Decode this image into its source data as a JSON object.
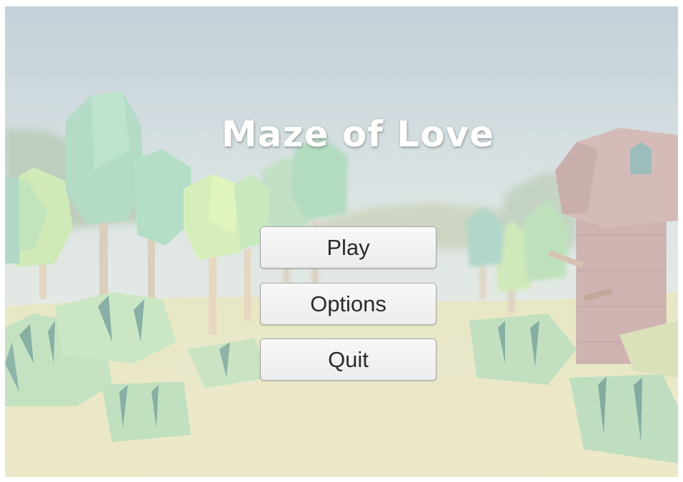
{
  "title": "Maze of Love",
  "menu": {
    "play_label": "Play",
    "options_label": "Options",
    "quit_label": "Quit"
  },
  "colors": {
    "sky_top": "#a9bcc6",
    "sky_bottom": "#dfe6e0",
    "ground": "#ddd9a3",
    "foliage": "#8fc6a0",
    "light_foliage": "#c8e59a",
    "tower": "#b79090",
    "button_bg": "#f2f2f2",
    "button_text": "#2b2b2b",
    "title_text": "#ffffff"
  }
}
